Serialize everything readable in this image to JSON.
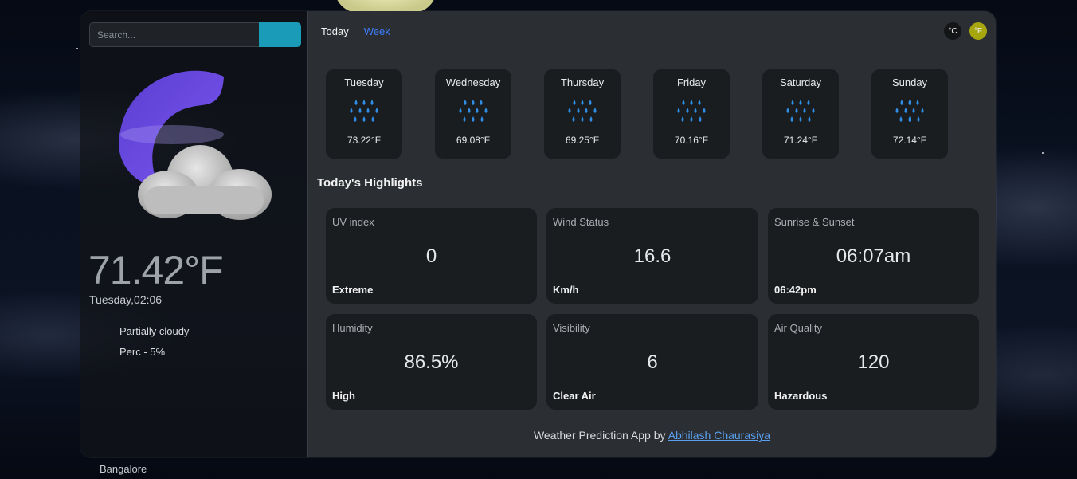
{
  "search": {
    "placeholder": "Search..."
  },
  "current": {
    "temperature": "71.42°F",
    "datetime": "Tuesday,02:06",
    "condition": "Partially cloudy",
    "precipitation": "Perc - 5%",
    "location": "Bangalore",
    "icon": "moon-cloud-icon"
  },
  "tabs": {
    "today": "Today",
    "week": "Week"
  },
  "units": {
    "celsius": "°C",
    "fahrenheit": "°F",
    "active": "fahrenheit"
  },
  "week": [
    {
      "day": "Tuesday",
      "temp": "73.22°F",
      "icon": "rain-icon"
    },
    {
      "day": "Wednesday",
      "temp": "69.08°F",
      "icon": "rain-icon"
    },
    {
      "day": "Thursday",
      "temp": "69.25°F",
      "icon": "rain-icon"
    },
    {
      "day": "Friday",
      "temp": "70.16°F",
      "icon": "rain-icon"
    },
    {
      "day": "Saturday",
      "temp": "71.24°F",
      "icon": "rain-icon"
    },
    {
      "day": "Sunday",
      "temp": "72.14°F",
      "icon": "rain-icon"
    }
  ],
  "highlights": {
    "title": "Today's Highlights",
    "cards": [
      {
        "title": "UV index",
        "value": "0",
        "sub": "Extreme"
      },
      {
        "title": "Wind Status",
        "value": "16.6",
        "sub": "Km/h"
      },
      {
        "title": "Sunrise & Sunset",
        "value": "06:07am",
        "sub": "06:42pm"
      },
      {
        "title": "Humidity",
        "value": "86.5%",
        "sub": "High"
      },
      {
        "title": "Visibility",
        "value": "6",
        "sub": "Clear Air"
      },
      {
        "title": "Air Quality",
        "value": "120",
        "sub": "Hazardous"
      }
    ]
  },
  "footer": {
    "text": "Weather Prediction App by",
    "author": "Abhilash Chaurasiya"
  },
  "colors": {
    "accent": "#1a9cb8",
    "link": "#3d7fff",
    "unit_active": "#a6a70f",
    "rain": "#2f8fe6"
  }
}
